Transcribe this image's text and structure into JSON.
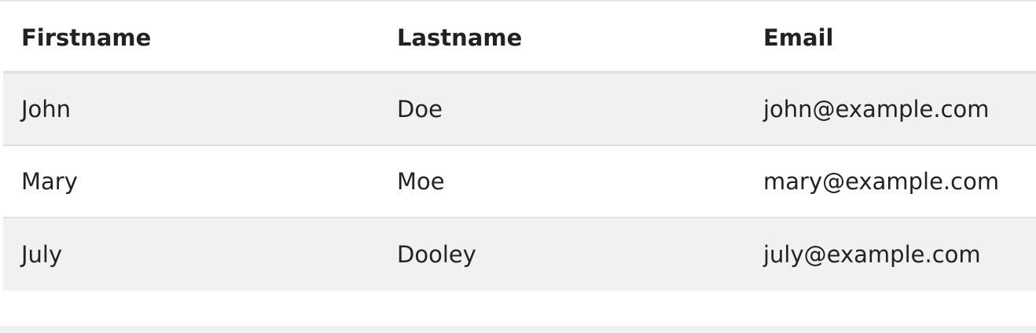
{
  "table": {
    "headers": [
      "Firstname",
      "Lastname",
      "Email"
    ],
    "rows": [
      [
        "John",
        "Doe",
        "john@example.com"
      ],
      [
        "Mary",
        "Moe",
        "mary@example.com"
      ],
      [
        "July",
        "Dooley",
        "july@example.com"
      ]
    ]
  },
  "colors": {
    "striped_row": "#f1f1f1",
    "header_border": "#dfe3e8",
    "text": "#222222"
  }
}
